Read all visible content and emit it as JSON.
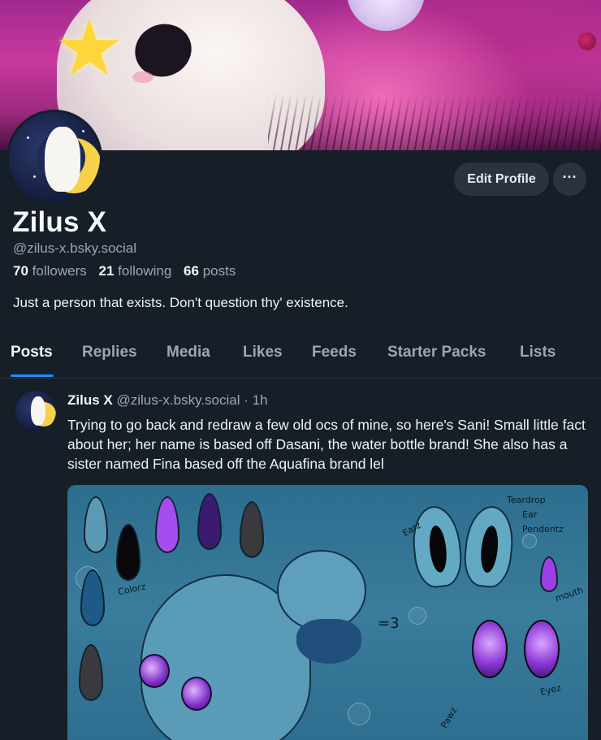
{
  "profile": {
    "display_name": "Zilus X",
    "handle": "@zilus-x.bsky.social",
    "bio": "Just a person that exists. Don't question thy' existence.",
    "stats": {
      "followers_count": "70",
      "followers_label": "followers",
      "following_count": "21",
      "following_label": "following",
      "posts_count": "66",
      "posts_label": "posts"
    }
  },
  "actions": {
    "edit_profile_label": "Edit Profile",
    "more_label": "···"
  },
  "tabs": [
    {
      "label": "Posts",
      "active": true
    },
    {
      "label": "Replies",
      "active": false
    },
    {
      "label": "Media",
      "active": false
    },
    {
      "label": "Likes",
      "active": false
    },
    {
      "label": "Feeds",
      "active": false
    },
    {
      "label": "Starter Packs",
      "active": false
    },
    {
      "label": "Lists",
      "active": false
    }
  ],
  "post": {
    "author_name": "Zilus X",
    "author_handle": "@zilus-x.bsky.social",
    "separator": "·",
    "time": "1h",
    "text": "Trying to go back and redraw a few old ocs of mine, so here's Sani! Small little fact about her; her name is based off Dasani, the water bottle brand! She also has a sister named Fina based off the Aquafina brand lel",
    "image_labels": {
      "colorz": "Colorz",
      "earz": "Earz",
      "teardrop": "Teardrop",
      "ear": "Ear",
      "pendentz": "Pendentz",
      "mouth": "mouth",
      "eyez": "Eyez",
      "pawz": "Pawz",
      "face": "=3"
    }
  },
  "colors": {
    "background": "#161e27",
    "accent": "#208bfe",
    "muted_text": "#9ba7b5",
    "button_bg": "#2a3441"
  },
  "icons": {
    "more": "ellipsis-icon",
    "banner_star": "star-icon"
  }
}
